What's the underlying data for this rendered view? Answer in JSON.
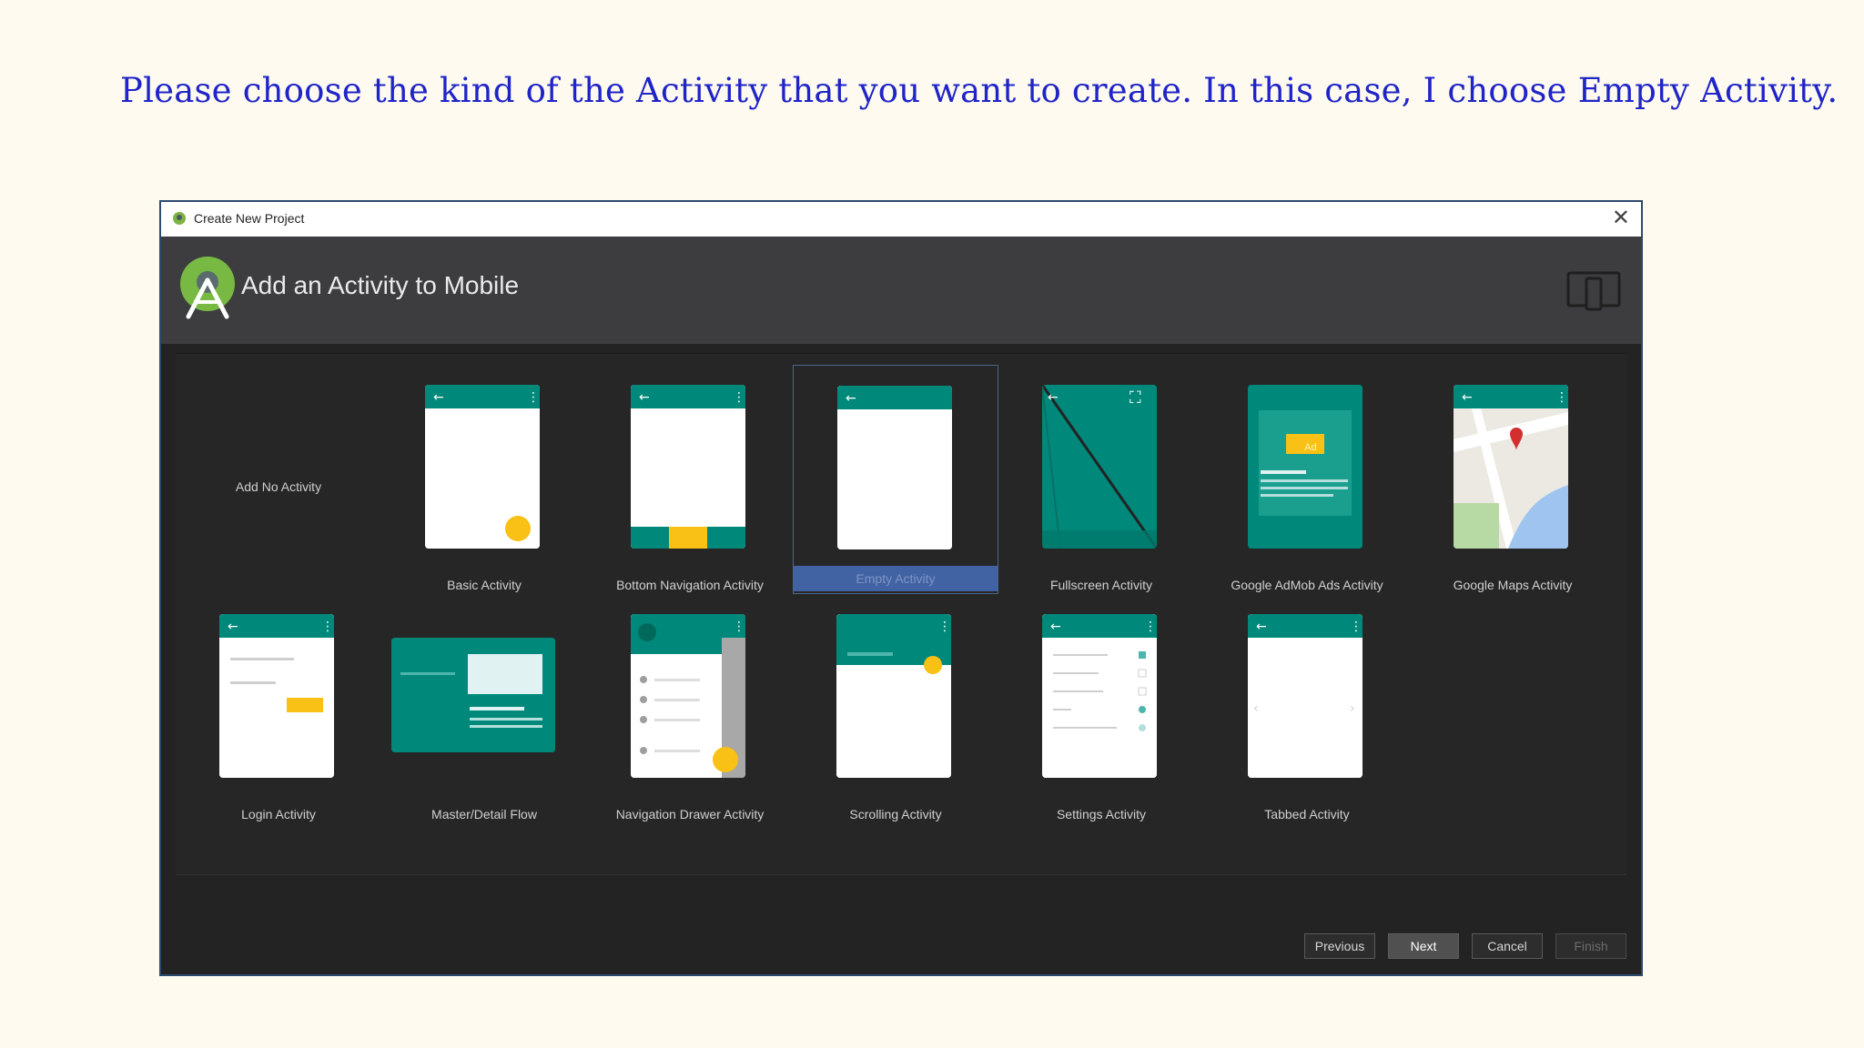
{
  "caption": "Please choose the kind of the Activity that you want to create. In this case, I choose Empty Activity.",
  "window": {
    "title": "Create New Project",
    "close_label": "✕"
  },
  "header": {
    "title": "Add an Activity to Mobile",
    "logo_icon": "android-studio-logo-icon",
    "device_icon": "device-form-factor-icon"
  },
  "activities": [
    {
      "label": "Add No Activity"
    },
    {
      "label": "Basic Activity"
    },
    {
      "label": "Bottom Navigation Activity"
    },
    {
      "label": "Empty Activity",
      "selected": true
    },
    {
      "label": "Fullscreen Activity"
    },
    {
      "label": "Google AdMob Ads Activity",
      "ad_badge": "Ad"
    },
    {
      "label": "Google Maps Activity"
    },
    {
      "label": "Login Activity"
    },
    {
      "label": "Master/Detail Flow"
    },
    {
      "label": "Navigation Drawer Activity"
    },
    {
      "label": "Scrolling Activity"
    },
    {
      "label": "Settings Activity"
    },
    {
      "label": "Tabbed Activity"
    }
  ],
  "buttons": {
    "previous": "Previous",
    "next": "Next",
    "cancel": "Cancel",
    "finish": "Finish"
  },
  "colors": {
    "caption": "#1f24c8",
    "teal": "#00897b",
    "accent": "#f9c015",
    "selection": "#4163a3",
    "dialog_bg": "#232323",
    "header_bg": "#3d3d3f"
  }
}
